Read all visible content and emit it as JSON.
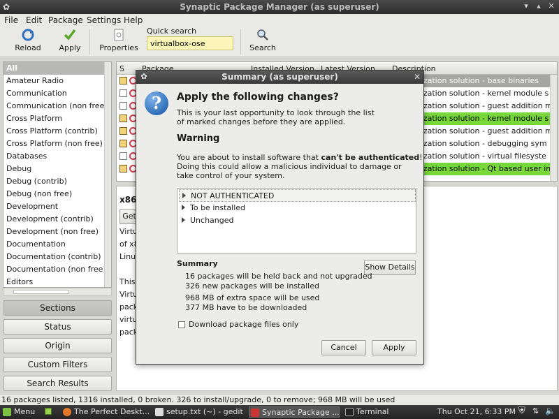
{
  "window": {
    "title": "Synaptic Package Manager  (as superuser)"
  },
  "menu": [
    "File",
    "Edit",
    "Package",
    "Settings",
    "Help"
  ],
  "toolbar": {
    "reload": "Reload",
    "apply": "Apply",
    "properties": "Properties",
    "quick_search_label": "Quick search",
    "quick_search_value": "virtualbox-ose",
    "search": "Search"
  },
  "sections": [
    "All",
    "Amateur Radio",
    "Communication",
    "Communication (non free)",
    "Cross Platform",
    "Cross Platform (contrib)",
    "Cross Platform (non free)",
    "Databases",
    "Debug",
    "Debug (contrib)",
    "Debug (non free)",
    "Development",
    "Development (contrib)",
    "Development (non free)",
    "Documentation",
    "Documentation (contrib)",
    "Documentation (non free)",
    "Editors"
  ],
  "nav_buttons": {
    "sections": "Sections",
    "status": "Status",
    "origin": "Origin",
    "custom_filters": "Custom Filters",
    "search_results": "Search Results"
  },
  "table": {
    "columns": {
      "s": "S",
      "package": "Package",
      "installed": "Installed Version",
      "latest": "Latest Version",
      "description": "Description"
    },
    "rows": [
      {
        "desc": "alization solution - base binaries",
        "mark": true,
        "style": "sel"
      },
      {
        "desc": "alization solution - kernel module s",
        "mark": false,
        "style": ""
      },
      {
        "desc": "alization solution - guest addition m",
        "mark": false,
        "style": ""
      },
      {
        "desc": "alization solution - kernel module s",
        "mark": true,
        "style": "green"
      },
      {
        "desc": "alization solution - guest addition m",
        "mark": true,
        "style": ""
      },
      {
        "desc": "alization solution - debugging sym",
        "mark": true,
        "style": ""
      },
      {
        "desc": "alization solution - virtual filesyste",
        "mark": false,
        "style": ""
      },
      {
        "desc": "alization solution - Qt based user in",
        "mark": true,
        "style": "green"
      }
    ]
  },
  "details": {
    "title": "x86",
    "get_btn": "Get",
    "lines": [
      "Virtu",
      "of x8",
      "Linux",
      "This",
      "Virtu",
      "pack",
      "virtu",
      "pack"
    ]
  },
  "dialog": {
    "title": "Summary (as superuser)",
    "heading": "Apply the following changes?",
    "intro_1": "This is your last opportunity to look through the list",
    "intro_2": "of marked changes before they are applied.",
    "warning_title": "Warning",
    "warning_1a": "You are about to install software that ",
    "warning_1b": "can't be authenticated",
    "warning_1c": "!",
    "warning_2": "Doing this could allow a malicious individual to damage or",
    "warning_3": "take control of your system.",
    "tree": [
      "NOT AUTHENTICATED",
      "To be installed",
      "Unchanged"
    ],
    "summary_title": "Summary",
    "show_details": "Show Details",
    "summary_1": "16 packages will be held back and not upgraded",
    "summary_2": "326 new packages will be installed",
    "summary_3": "968 MB of extra space will be used",
    "summary_4": "377 MB have to be downloaded",
    "download_only": "Download package files only",
    "cancel": "Cancel",
    "apply": "Apply"
  },
  "statusbar": "16 packages listed, 1316 installed, 0 broken. 326 to install/upgrade, 0 to remove; 968 MB will be used",
  "taskbar": {
    "menu": "Menu",
    "items": [
      "The Perfect Deskt...",
      "setup.txt (~) - gedit",
      "Synaptic Package ...",
      "Terminal"
    ],
    "clock": "Thu Oct 21,  6:33 PM"
  }
}
